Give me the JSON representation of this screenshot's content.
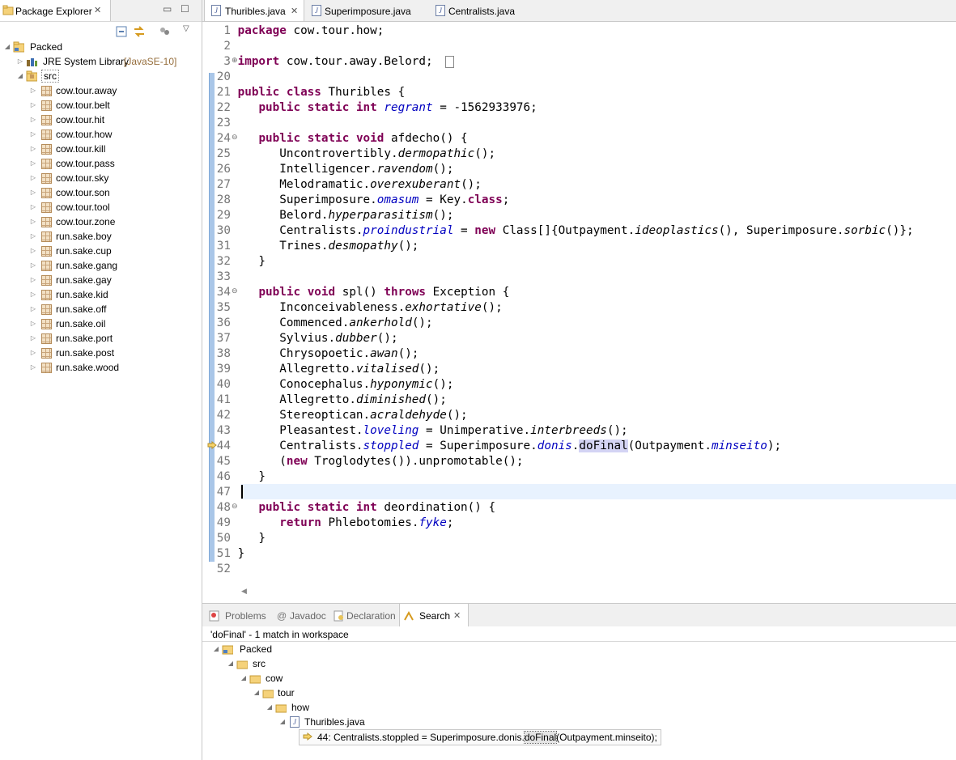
{
  "package_explorer": {
    "title": "Package Explorer",
    "project": "Packed",
    "jre": {
      "label": "JRE System Library",
      "version": "[JavaSE-10]"
    },
    "src": "src",
    "packages": [
      "cow.tour.away",
      "cow.tour.belt",
      "cow.tour.hit",
      "cow.tour.how",
      "cow.tour.kill",
      "cow.tour.pass",
      "cow.tour.sky",
      "cow.tour.son",
      "cow.tour.tool",
      "cow.tour.zone",
      "run.sake.boy",
      "run.sake.cup",
      "run.sake.gang",
      "run.sake.gay",
      "run.sake.kid",
      "run.sake.off",
      "run.sake.oil",
      "run.sake.port",
      "run.sake.post",
      "run.sake.wood"
    ]
  },
  "editor": {
    "tabs": [
      {
        "label": "Thuribles.java",
        "active": true
      },
      {
        "label": "Superimposure.java",
        "active": false
      },
      {
        "label": "Centralists.java",
        "active": false
      }
    ],
    "lines": [
      {
        "n": "1",
        "code": "<span class='kw'>package</span> cow.tour.how;"
      },
      {
        "n": "2",
        "code": ""
      },
      {
        "n": "3",
        "code": "<span class='kw'>import</span> cow.tour.away.Belord;"
      },
      {
        "n": "20",
        "code": ""
      },
      {
        "n": "21",
        "code": "<span class='kw'>public class</span> Thuribles {"
      },
      {
        "n": "22",
        "code": "   <span class='kw'>public static int</span> <span class='fld'>regrant</span> = -1562933976;"
      },
      {
        "n": "23",
        "code": ""
      },
      {
        "n": "24",
        "code": "   <span class='kw'>public static void</span> afdecho() {"
      },
      {
        "n": "25",
        "code": "      Uncontrovertibly.<span class='mth'>dermopathic</span>();"
      },
      {
        "n": "26",
        "code": "      Intelligencer.<span class='mth'>ravendom</span>();"
      },
      {
        "n": "27",
        "code": "      Melodramatic.<span class='mth'>overexuberant</span>();"
      },
      {
        "n": "28",
        "code": "      Superimposure.<span class='fld'>omasum</span> = Key.<span class='kw'>class</span>;"
      },
      {
        "n": "29",
        "code": "      Belord.<span class='mth'>hyperparasitism</span>();"
      },
      {
        "n": "30",
        "code": "      Centralists.<span class='fld'>proindustrial</span> = <span class='kw'>new</span> Class[]{Outpayment.<span class='mth'>ideoplastics</span>(), Superimposure.<span class='mth'>sorbic</span>()};"
      },
      {
        "n": "31",
        "code": "      Trines.<span class='mth'>desmopathy</span>();"
      },
      {
        "n": "32",
        "code": "   }"
      },
      {
        "n": "33",
        "code": ""
      },
      {
        "n": "34",
        "code": "   <span class='kw'>public void</span> spl() <span class='kw'>throws</span> Exception {"
      },
      {
        "n": "35",
        "code": "      Inconceivableness.<span class='mth'>exhortative</span>();"
      },
      {
        "n": "36",
        "code": "      Commenced.<span class='mth'>ankerhold</span>();"
      },
      {
        "n": "37",
        "code": "      Sylvius.<span class='mth'>dubber</span>();"
      },
      {
        "n": "38",
        "code": "      Chrysopoetic.<span class='mth'>awan</span>();"
      },
      {
        "n": "39",
        "code": "      Allegretto.<span class='mth'>vitalised</span>();"
      },
      {
        "n": "40",
        "code": "      Conocephalus.<span class='mth'>hyponymic</span>();"
      },
      {
        "n": "41",
        "code": "      Allegretto.<span class='mth'>diminished</span>();"
      },
      {
        "n": "42",
        "code": "      Stereoptican.<span class='mth'>acraldehyde</span>();"
      },
      {
        "n": "43",
        "code": "      Pleasantest.<span class='fld'>loveling</span> = Unimperative.<span class='mth'>interbreeds</span>();"
      },
      {
        "n": "44",
        "code": "      Centralists.<span class='fld'>stoppled</span> = Superimposure.<span class='fld'>donis</span>.<span class='hl-word'>doFinal</span>(Outpayment.<span class='fld'>minseito</span>);"
      },
      {
        "n": "45",
        "code": "      (<span class='kw'>new</span> Troglodytes()).unpromotable();"
      },
      {
        "n": "46",
        "code": "   }"
      },
      {
        "n": "47",
        "code": ""
      },
      {
        "n": "48",
        "code": "   <span class='kw'>public static int</span> deordination() {"
      },
      {
        "n": "49",
        "code": "      <span class='kw'>return</span> Phlebotomies.<span class='fld'>fyke</span>;"
      },
      {
        "n": "50",
        "code": "   }"
      },
      {
        "n": "51",
        "code": "}"
      },
      {
        "n": "52",
        "code": ""
      }
    ]
  },
  "bottom_panel": {
    "tabs": [
      "Problems",
      "Javadoc",
      "Declaration",
      "Search"
    ],
    "active_tab": "Search",
    "summary": "'doFinal' - 1 match in workspace",
    "tree": {
      "project": "Packed",
      "src": "src",
      "cow": "cow",
      "tour": "tour",
      "how": "how",
      "file": "Thuribles.java",
      "match_prefix": "44: Centralists.stoppled = Superimposure.donis.",
      "match_word": "doFinal",
      "match_suffix": "(Outpayment.minseito);"
    }
  },
  "colors": {
    "keyword": "#7f0055",
    "field": "#0000c0",
    "current_line": "#e8f2fe",
    "word_highlight": "#d4d4f4"
  }
}
